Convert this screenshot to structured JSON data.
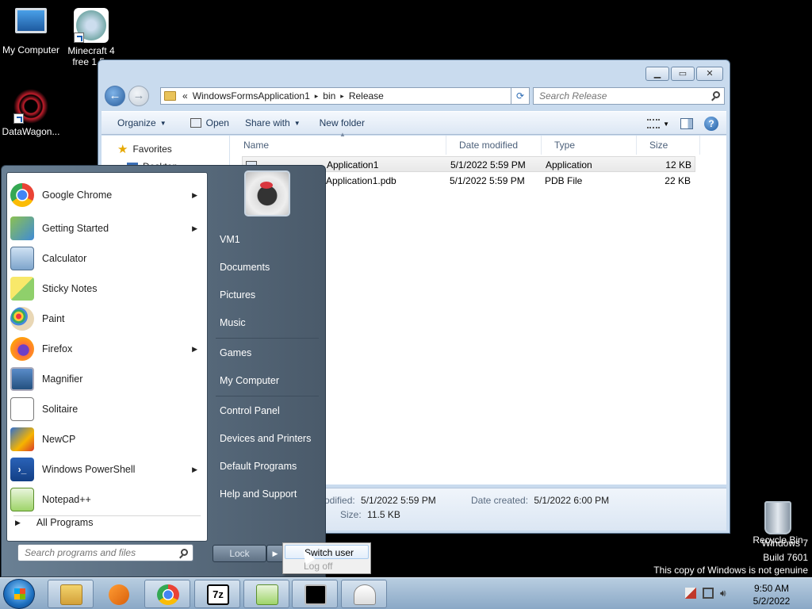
{
  "desktop": {
    "icons": [
      {
        "label": "My Computer"
      },
      {
        "label": "Minecraft 4 free 1.5.."
      },
      {
        "label": "DataWagon..."
      }
    ],
    "recycle_bin": "Recycle Bin",
    "watermark": {
      "line1": "Windows 7",
      "line2": "Build 7601",
      "line3": "This copy of Windows is not genuine"
    }
  },
  "explorer": {
    "breadcrumb": {
      "prefix": "«",
      "parts": [
        "WindowsFormsApplication1",
        "bin",
        "Release"
      ],
      "separator": "▸"
    },
    "search_placeholder": "Search Release",
    "toolbar": {
      "organize": "Organize",
      "open": "Open",
      "share_with": "Share with",
      "new_folder": "New folder"
    },
    "nav": {
      "favorites": "Favorites",
      "desktop": "Desktop"
    },
    "columns": [
      "Name",
      "Date modified",
      "Type",
      "Size"
    ],
    "files": [
      {
        "name": "WindowsFormsApplication1",
        "date": "5/1/2022 5:59 PM",
        "type": "Application",
        "size": "12 KB"
      },
      {
        "name": "WindowsFormsApplication1.pdb",
        "date": "5/1/2022 5:59 PM",
        "type": "PDB File",
        "size": "22 KB"
      }
    ],
    "visible_file_names": [
      "Application1",
      "Application1.pdb"
    ],
    "details": {
      "modified_label": "odified:",
      "modified_value": "5/1/2022 5:59 PM",
      "created_label": "Date created:",
      "created_value": "5/1/2022 6:00 PM",
      "size_label": "Size:",
      "size_value": "11.5 KB"
    }
  },
  "start_menu": {
    "programs": [
      {
        "label": "Google Chrome",
        "arrow": true,
        "icon": "chrome-icon"
      },
      {
        "label": "Getting Started",
        "arrow": true,
        "icon": "getting-started-icon"
      },
      {
        "label": "Calculator",
        "arrow": false,
        "icon": "calculator-icon"
      },
      {
        "label": "Sticky Notes",
        "arrow": false,
        "icon": "sticky-notes-icon"
      },
      {
        "label": "Paint",
        "arrow": false,
        "icon": "paint-icon"
      },
      {
        "label": "Firefox",
        "arrow": true,
        "icon": "firefox-icon"
      },
      {
        "label": "Magnifier",
        "arrow": false,
        "icon": "magnifier-icon"
      },
      {
        "label": "Solitaire",
        "arrow": false,
        "icon": "solitaire-icon"
      },
      {
        "label": "NewCP",
        "arrow": false,
        "icon": "newcp-icon"
      },
      {
        "label": "Windows PowerShell",
        "arrow": true,
        "icon": "powershell-icon"
      },
      {
        "label": "Notepad++",
        "arrow": false,
        "icon": "notepadpp-icon"
      }
    ],
    "all_programs": "All Programs",
    "search_placeholder": "Search programs and files",
    "right_links": [
      "VM1",
      "Documents",
      "Pictures",
      "Music",
      "Games",
      "My Computer",
      "Control Panel",
      "Devices and Printers",
      "Default Programs",
      "Help and Support"
    ],
    "lock_label": "Lock",
    "power_menu": {
      "switch_user": "Switch user",
      "log_off": "Log off"
    }
  },
  "taskbar": {
    "clock_time": "9:50 AM",
    "clock_date": "5/2/2022",
    "pinned": [
      "explorer-icon",
      "media-player-icon",
      "chrome-icon",
      "7zip-icon",
      "notepadpp-icon",
      "cmd-icon",
      "java-icon"
    ]
  },
  "colors": {
    "desktop_bg": "#000000",
    "taskbar": "#9fb8d2",
    "start_menu_right": "#5b6d80",
    "accent": "#1e5aa0"
  }
}
